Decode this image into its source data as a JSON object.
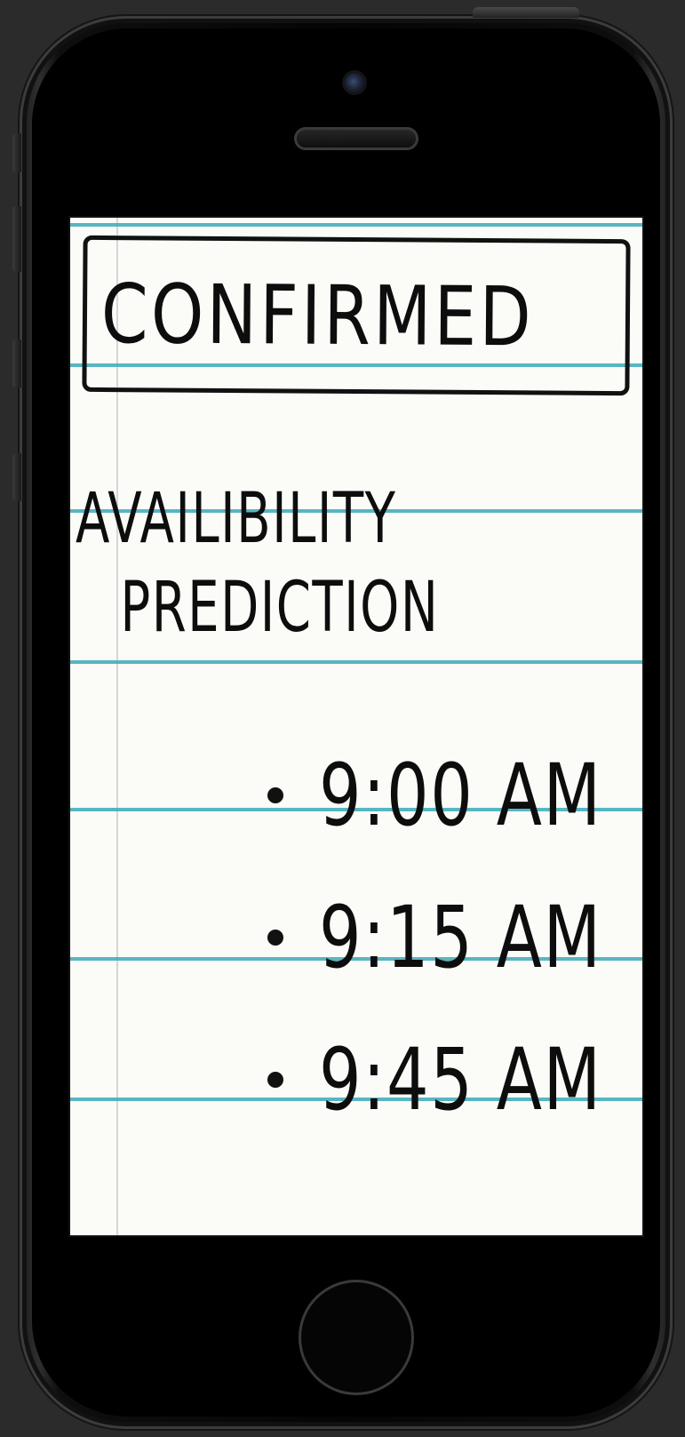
{
  "screen": {
    "title": "CONFIRMED",
    "heading_line1": "AVAILIBILITY",
    "heading_line2": "PREDICTION",
    "times": [
      "9:00 AM",
      "9:15 AM",
      "9:45 AM"
    ]
  },
  "colors": {
    "background": "#2b2b2b",
    "phone_body": "#050505",
    "paper": "#fbfbf7",
    "ruled_line": "#3aa9b8",
    "ink": "#0d0d0d"
  },
  "icons": {
    "camera": "front-camera-icon",
    "speaker": "earpiece-speaker-icon",
    "home": "home-button-icon"
  }
}
